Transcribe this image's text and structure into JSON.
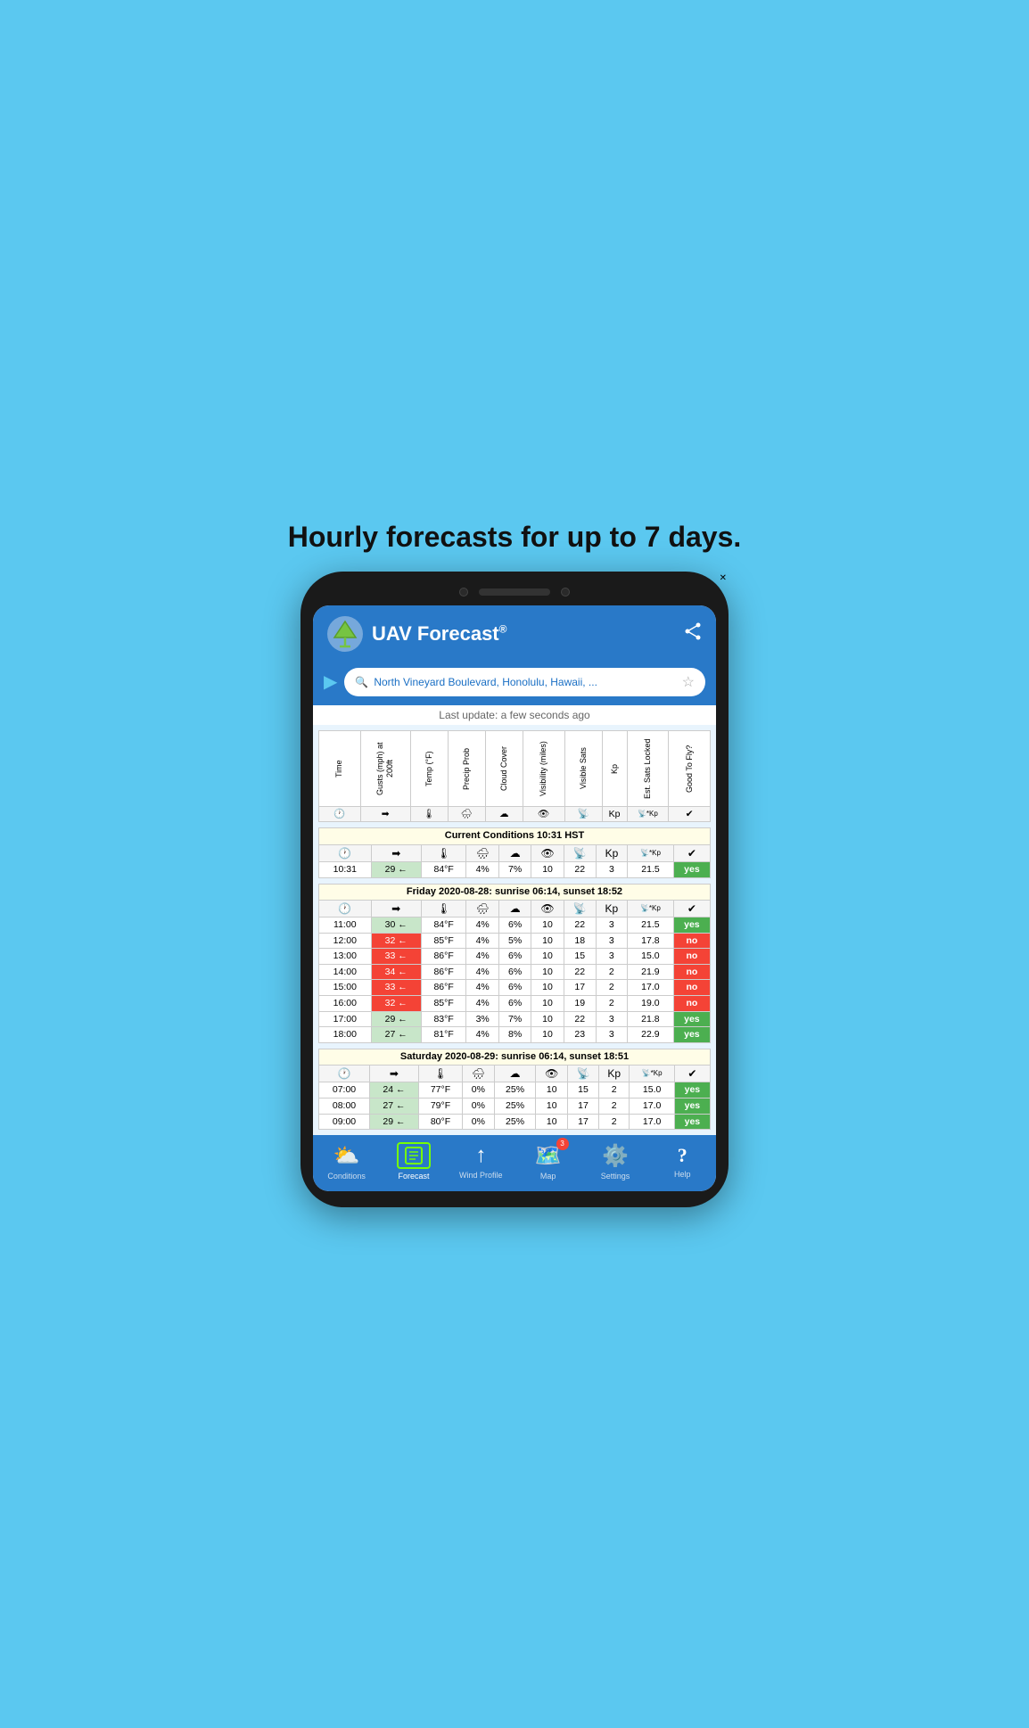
{
  "headline": "Hourly forecasts for up to 7 days.",
  "header": {
    "title": "UAV Forecast",
    "registered": "®",
    "share_icon": "⋮"
  },
  "search": {
    "placeholder": "North Vineyard Boulevard, Honolulu, Hawaii, ...",
    "location_icon": "▶",
    "search_icon": "🔍",
    "star_icon": "☆"
  },
  "last_update": "Last update: a few seconds ago",
  "table_headers": {
    "time": "Time",
    "gusts": "Gusts (mph) at 200ft",
    "temp": "Temp (°F)",
    "precip": "Precip Prob",
    "cloud": "Cloud Cover",
    "visibility": "Visibility (miles)",
    "sats": "Visible Sats",
    "kp": "Kp",
    "est_sats": "Est. Sats Locked",
    "good_to_fly": "Good To Fly?"
  },
  "current_conditions": {
    "header": "Current Conditions 10:31 HST",
    "row": {
      "time": "10:31",
      "gusts": "29 ←",
      "temp": "84°F",
      "precip": "4%",
      "cloud": "7%",
      "visibility": "10",
      "sats": "22",
      "kp": "3",
      "est_sats": "21.5",
      "good": "yes",
      "gusts_color": "light-green",
      "good_color": "yes"
    }
  },
  "friday": {
    "header": "Friday 2020-08-28: sunrise 06:14, sunset 18:52",
    "rows": [
      {
        "time": "11:00",
        "gusts": "30 ←",
        "temp": "84°F",
        "precip": "4%",
        "cloud": "6%",
        "visibility": "10",
        "sats": "22",
        "kp": "3",
        "est_sats": "21.5",
        "good": "yes",
        "gusts_color": "light-green",
        "good_color": "yes"
      },
      {
        "time": "12:00",
        "gusts": "32 ←",
        "temp": "85°F",
        "precip": "4%",
        "cloud": "5%",
        "visibility": "10",
        "sats": "18",
        "kp": "3",
        "est_sats": "17.8",
        "good": "no",
        "gusts_color": "red",
        "good_color": "no"
      },
      {
        "time": "13:00",
        "gusts": "33 ←",
        "temp": "86°F",
        "precip": "4%",
        "cloud": "6%",
        "visibility": "10",
        "sats": "15",
        "kp": "3",
        "est_sats": "15.0",
        "good": "no",
        "gusts_color": "red",
        "good_color": "no"
      },
      {
        "time": "14:00",
        "gusts": "34 ←",
        "temp": "86°F",
        "precip": "4%",
        "cloud": "6%",
        "visibility": "10",
        "sats": "22",
        "kp": "2",
        "est_sats": "21.9",
        "good": "no",
        "gusts_color": "red",
        "good_color": "no"
      },
      {
        "time": "15:00",
        "gusts": "33 ←",
        "temp": "86°F",
        "precip": "4%",
        "cloud": "6%",
        "visibility": "10",
        "sats": "17",
        "kp": "2",
        "est_sats": "17.0",
        "good": "no",
        "gusts_color": "red",
        "good_color": "no"
      },
      {
        "time": "16:00",
        "gusts": "32 ←",
        "temp": "85°F",
        "precip": "4%",
        "cloud": "6%",
        "visibility": "10",
        "sats": "19",
        "kp": "2",
        "est_sats": "19.0",
        "good": "no",
        "gusts_color": "red",
        "good_color": "no"
      },
      {
        "time": "17:00",
        "gusts": "29 ←",
        "temp": "83°F",
        "precip": "3%",
        "cloud": "7%",
        "visibility": "10",
        "sats": "22",
        "kp": "3",
        "est_sats": "21.8",
        "good": "yes",
        "gusts_color": "light-green",
        "good_color": "yes"
      },
      {
        "time": "18:00",
        "gusts": "27 ←",
        "temp": "81°F",
        "precip": "4%",
        "cloud": "8%",
        "visibility": "10",
        "sats": "23",
        "kp": "3",
        "est_sats": "22.9",
        "good": "yes",
        "gusts_color": "light-green",
        "good_color": "yes"
      }
    ]
  },
  "saturday": {
    "header": "Saturday 2020-08-29: sunrise 06:14, sunset 18:51",
    "rows": [
      {
        "time": "07:00",
        "gusts": "24 ←",
        "temp": "77°F",
        "precip": "0%",
        "cloud": "25%",
        "visibility": "10",
        "sats": "15",
        "kp": "2",
        "est_sats": "15.0",
        "good": "yes",
        "gusts_color": "light-green",
        "good_color": "yes"
      },
      {
        "time": "08:00",
        "gusts": "27 ←",
        "temp": "79°F",
        "precip": "0%",
        "cloud": "25%",
        "visibility": "10",
        "sats": "17",
        "kp": "2",
        "est_sats": "17.0",
        "good": "yes",
        "gusts_color": "light-green",
        "good_color": "yes"
      },
      {
        "time": "09:00",
        "gusts": "29 ←",
        "temp": "80°F",
        "precip": "0%",
        "cloud": "25%",
        "visibility": "10",
        "sats": "17",
        "kp": "2",
        "est_sats": "17.0",
        "good": "yes",
        "gusts_color": "light-green",
        "good_color": "yes"
      }
    ]
  },
  "nav": {
    "items": [
      {
        "id": "conditions",
        "label": "Conditions",
        "icon": "☁️",
        "active": false
      },
      {
        "id": "forecast",
        "label": "Forecast",
        "icon": "📋",
        "active": true
      },
      {
        "id": "wind_profile",
        "label": "Wind Profile",
        "icon": "↑",
        "active": false
      },
      {
        "id": "map",
        "label": "Map",
        "icon": "🗺️",
        "active": false,
        "badge": "3"
      },
      {
        "id": "settings",
        "label": "Settings",
        "icon": "⚙️",
        "active": false
      },
      {
        "id": "help",
        "label": "Help",
        "icon": "?",
        "active": false
      }
    ]
  }
}
